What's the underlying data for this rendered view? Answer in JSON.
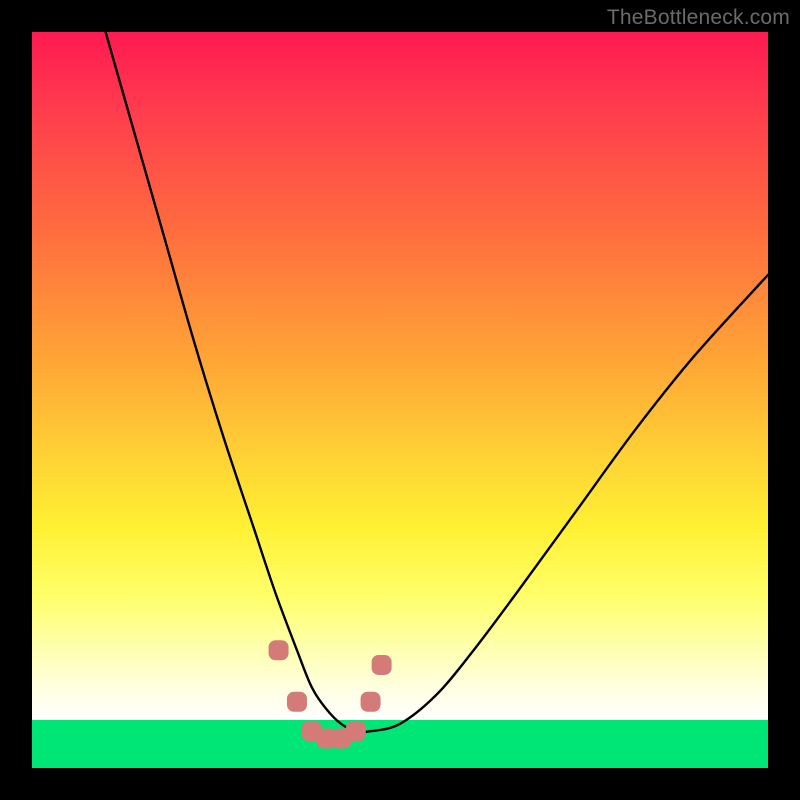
{
  "watermark": "TheBottleneck.com",
  "chart_data": {
    "type": "line",
    "title": "",
    "xlabel": "",
    "ylabel": "",
    "xlim": [
      0,
      100
    ],
    "ylim": [
      0,
      100
    ],
    "series": [
      {
        "name": "bottleneck-curve",
        "x": [
          10,
          14,
          18,
          22,
          26,
          30,
          33,
          36,
          38,
          40,
          42,
          44,
          46,
          50,
          55,
          60,
          66,
          74,
          82,
          90,
          100
        ],
        "values": [
          100,
          86,
          72,
          58,
          45,
          33,
          24,
          16,
          11,
          8,
          6,
          5,
          5,
          6,
          10,
          16,
          24,
          35,
          46,
          56,
          67
        ]
      }
    ],
    "markers": {
      "name": "optimal-range-markers",
      "x": [
        33.5,
        36,
        38,
        40,
        42,
        44,
        46,
        47.5
      ],
      "values": [
        16,
        9,
        5,
        4,
        4,
        5,
        9,
        14
      ]
    },
    "colors": {
      "gradient_top": "#ff1a52",
      "gradient_mid": "#fff033",
      "gradient_bottom": "#ffffff",
      "base_green": "#00e676",
      "curve": "#000000",
      "marker": "#d47a78"
    }
  }
}
